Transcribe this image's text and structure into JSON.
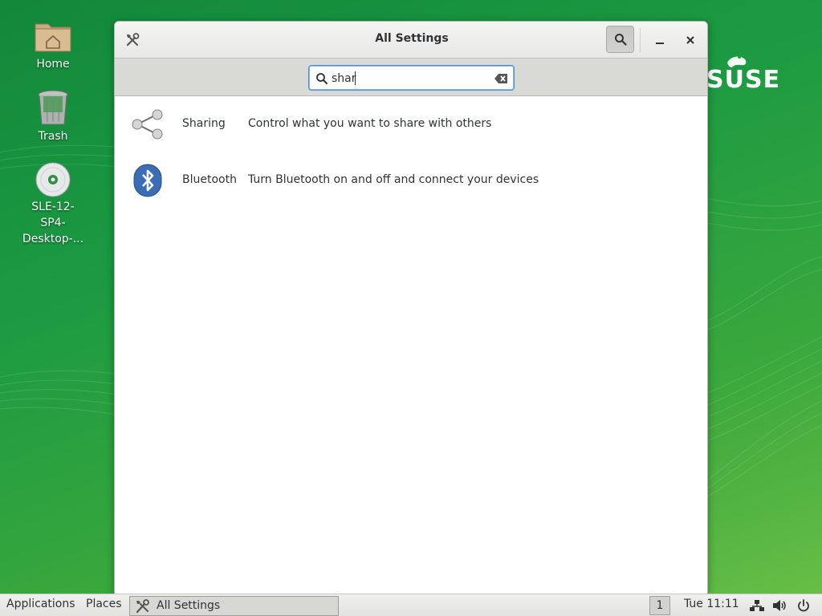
{
  "desktop": {
    "icons": [
      {
        "label": "Home",
        "icon": "home-folder-icon"
      },
      {
        "label": "Trash",
        "icon": "trash-icon"
      },
      {
        "label_lines": [
          "SLE-12-",
          "SP4-",
          "Desktop-..."
        ],
        "icon": "disc-icon"
      }
    ],
    "brand": "SUSE"
  },
  "window": {
    "title": "All Settings",
    "search": {
      "value": "shar",
      "placeholder": ""
    },
    "results": [
      {
        "name": "Sharing",
        "description": "Control what you want to share with others",
        "icon": "sharing-icon"
      },
      {
        "name": "Bluetooth",
        "description": "Turn Bluetooth on and off and connect your devices",
        "icon": "bluetooth-icon"
      }
    ]
  },
  "panel": {
    "applications": "Applications",
    "places": "Places",
    "task_label": "All Settings",
    "workspace": "1",
    "clock": "Tue 11:11"
  },
  "colors": {
    "desktop_green": "#1c9a42",
    "accent_blue": "#4a90d9",
    "bluetooth_blue": "#3b6db5"
  }
}
